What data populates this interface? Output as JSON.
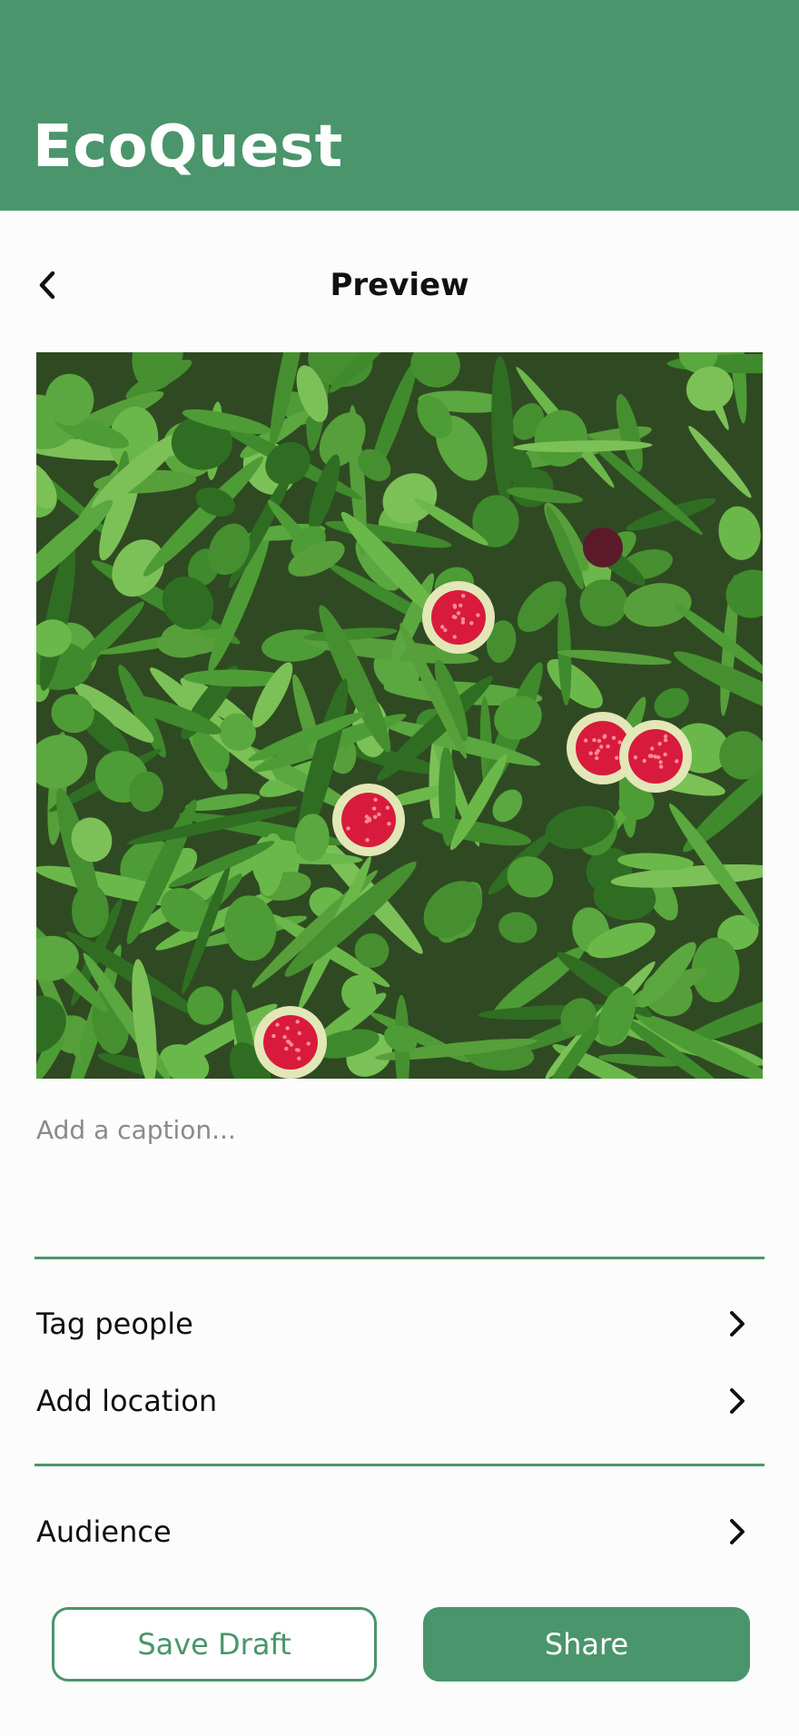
{
  "app": {
    "title": "EcoQuest"
  },
  "nav": {
    "back_icon": "chevron-left-icon",
    "page_title": "Preview"
  },
  "photo": {
    "subject": "wild strawberries among green leaves"
  },
  "caption": {
    "value": "",
    "placeholder": "Add a caption..."
  },
  "options": {
    "tag_people": "Tag people",
    "add_location": "Add location",
    "audience": "Audience",
    "chevron_icon": "chevron-right-icon"
  },
  "actions": {
    "save_draft": "Save Draft",
    "share": "Share"
  },
  "colors": {
    "brand": "#4a956b",
    "background": "#fcfcfc",
    "text": "#111111",
    "placeholder": "#8a8a8a",
    "berry": "#d81b3c"
  }
}
